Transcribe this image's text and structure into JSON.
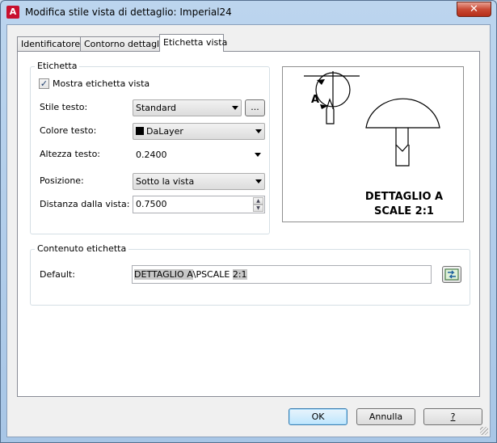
{
  "window": {
    "title": "Modifica stile vista di dettaglio: Imperial24",
    "close_label": "✕",
    "app_icon": "autocad-icon"
  },
  "tabs": [
    {
      "label": "Identificatore",
      "active": false
    },
    {
      "label": "Contorno dettaglio",
      "active": false
    },
    {
      "label": "Etichetta vista",
      "active": true
    }
  ],
  "etichetta": {
    "group_title": "Etichetta",
    "show_label": {
      "label": "Mostra etichetta vista",
      "checked": true
    },
    "style": {
      "label": "Stile testo:",
      "value": "Standard",
      "browse_label": "..."
    },
    "color": {
      "label": "Colore testo:",
      "value": "DaLayer"
    },
    "height": {
      "label": "Altezza testo:",
      "value": "0.2400"
    },
    "position": {
      "label": "Posizione:",
      "value": "Sotto la vista"
    },
    "distance": {
      "label": "Distanza dalla vista:",
      "value": "0.7500"
    }
  },
  "preview": {
    "callout_letter": "A",
    "caption_line1": "DETTAGLIO A",
    "caption_line2": "SCALE 2:1"
  },
  "contenuto": {
    "group_title": "Contenuto etichetta",
    "default_label": "Default:",
    "value_part1": "DETTAGLIO",
    "value_part2": " A",
    "value_part3": "\\PSCALE ",
    "value_part4": "2:1"
  },
  "buttons": {
    "ok": "OK",
    "cancel": "Annulla",
    "help": "?"
  }
}
